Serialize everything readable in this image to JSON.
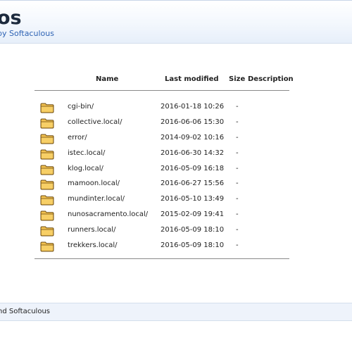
{
  "header": {
    "brand_fragment": "os",
    "subtitle": "by Softaculous"
  },
  "table": {
    "columns": {
      "name": "Name",
      "last_modified": "Last modified",
      "size": "Size",
      "description": "Description"
    },
    "rows": [
      {
        "icon": "folder-icon",
        "name": "cgi-bin/",
        "modified": "2016-01-18 10:26",
        "size": "-"
      },
      {
        "icon": "folder-icon",
        "name": "collective.local/",
        "modified": "2016-06-06 15:30",
        "size": "-"
      },
      {
        "icon": "folder-icon",
        "name": "error/",
        "modified": "2014-09-02 10:16",
        "size": "-"
      },
      {
        "icon": "folder-icon",
        "name": "istec.local/",
        "modified": "2016-06-30 14:32",
        "size": "-"
      },
      {
        "icon": "folder-icon",
        "name": "klog.local/",
        "modified": "2016-05-09 16:18",
        "size": "-"
      },
      {
        "icon": "folder-icon",
        "name": "mamoon.local/",
        "modified": "2016-06-27 15:56",
        "size": "-"
      },
      {
        "icon": "folder-icon",
        "name": "mundinter.local/",
        "modified": "2016-05-10 13:49",
        "size": "-"
      },
      {
        "icon": "folder-icon",
        "name": "nunosacramento.local/",
        "modified": "2015-02-09 19:41",
        "size": "-"
      },
      {
        "icon": "folder-icon",
        "name": "runners.local/",
        "modified": "2016-05-09 18:10",
        "size": "-"
      },
      {
        "icon": "folder-icon",
        "name": "trekkers.local/",
        "modified": "2016-05-09 18:10",
        "size": "-"
      }
    ]
  },
  "footer": {
    "text": "nd Softaculous"
  },
  "colors": {
    "link_blue": "#2f63b4",
    "folder_fill": "#f2c14f",
    "folder_stroke": "#6b4a10",
    "footer_bg": "#eef3fb"
  }
}
